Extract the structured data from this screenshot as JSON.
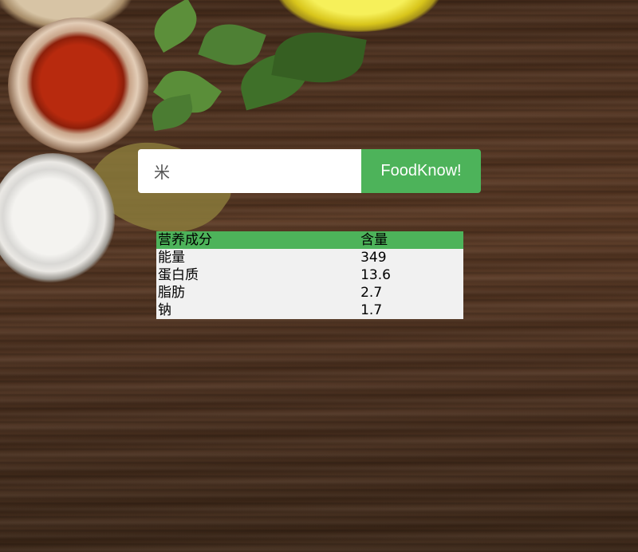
{
  "search": {
    "value": "米",
    "button_label": "FoodKnow!"
  },
  "nutrition_table": {
    "headers": [
      "营养成分",
      "含量"
    ],
    "rows": [
      [
        "能量",
        "349"
      ],
      [
        "蛋白质",
        "13.6"
      ],
      [
        "脂肪",
        "2.7"
      ],
      [
        "钠",
        "1.7"
      ]
    ]
  },
  "colors": {
    "accent": "#4db35a",
    "table_row_bg": "#f1f1f1"
  }
}
